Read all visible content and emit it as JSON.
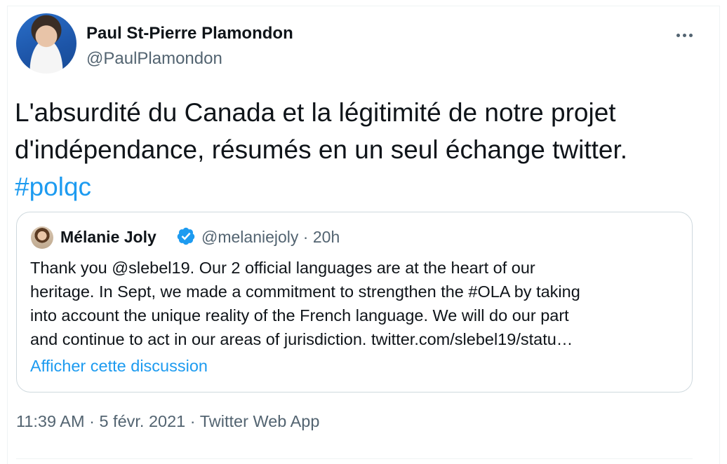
{
  "author": {
    "name": "Paul St-Pierre Plamondon",
    "handle": "@PaulPlamondon"
  },
  "tweet": {
    "lines": [
      "L'absurdité du Canada et la légitimité de notre projet",
      "d'indépendance, résumés en un seul échange twitter."
    ],
    "hashtag": "#polqc"
  },
  "quoted": {
    "name": "Mélanie Joly",
    "handle": "@melaniejoly",
    "separator": "·",
    "time": "20h",
    "lines": [
      "Thank you @slebel19. Our 2 official languages are at the heart of our",
      "heritage. In Sept, we made a commitment to strengthen the #OLA by taking",
      "into account the unique reality of the French language. We will do our part",
      "and continue to act in our areas of jurisdiction. twitter.com/slebel19/statu…"
    ],
    "show_thread_label": "Afficher cette discussion"
  },
  "footer": {
    "time": "11:39 AM",
    "separator": "·",
    "date": "5 févr. 2021",
    "source": "Twitter Web App"
  },
  "icons": {
    "more": "more-horizontal-icon",
    "verified": "verified-badge-icon"
  },
  "colors": {
    "link": "#1d9bf0",
    "secondary_text": "#536471",
    "primary_text": "#0f1419",
    "border": "#cfd9de"
  }
}
